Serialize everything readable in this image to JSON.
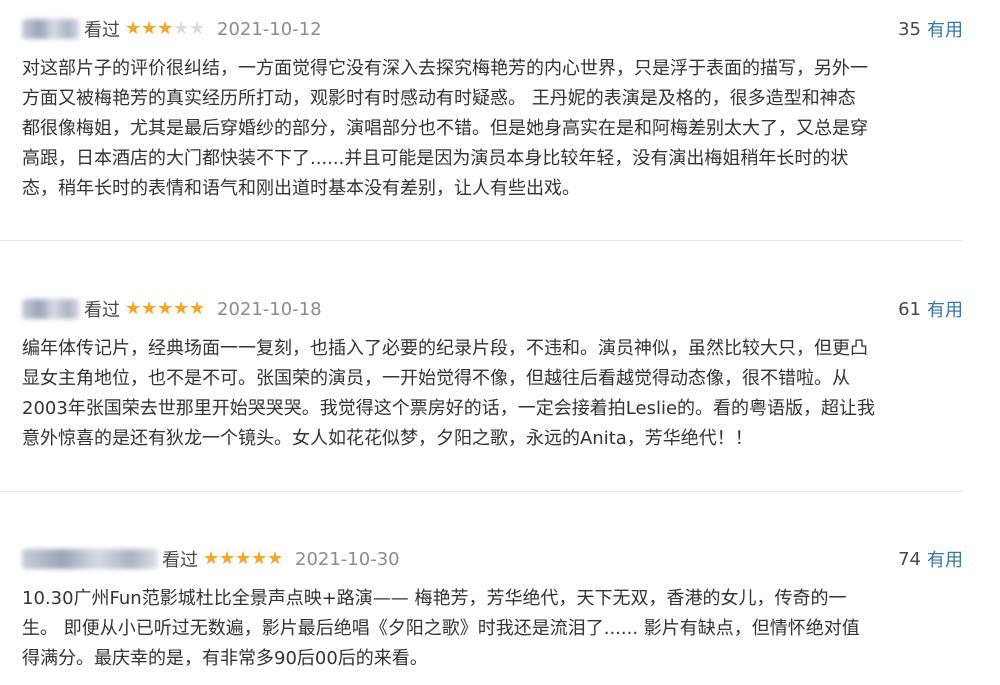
{
  "reviews": [
    {
      "watched_label": "看过",
      "rating": 3,
      "max_rating": 5,
      "date": "2021-10-12",
      "useful_count": "35",
      "useful_label": "有用",
      "lines": [
        "对这部片子的评价很纠结，一方面觉得它没有深入去探究梅艳芳的内心世界，只是浮于表面的描写，另外一",
        "方面又被梅艳芳的真实经历所打动，观影时有时感动有时疑惑。 王丹妮的表演是及格的，很多造型和神态",
        "都很像梅姐，尤其是最后穿婚纱的部分，演唱部分也不错。但是她身高实在是和阿梅差别太大了，又总是穿",
        "高跟，日本酒店的大门都快装不下了......并且可能是因为演员本身比较年轻，没有演出梅姐稍年长时的状",
        "态，稍年长时的表情和语气和刚出道时基本没有差别，让人有些出戏。"
      ]
    },
    {
      "watched_label": "看过",
      "rating": 5,
      "max_rating": 5,
      "date": "2021-10-18",
      "useful_count": "61",
      "useful_label": "有用",
      "lines": [
        "编年体传记片，经典场面一一复刻，也插入了必要的纪录片段，不违和。演员神似，虽然比较大只，但更凸",
        "显女主角地位，也不是不可。张国荣的演员，一开始觉得不像，但越往后看越觉得动态像，很不错啦。从",
        "2003年张国荣去世那里开始哭哭哭。我觉得这个票房好的话，一定会接着拍Leslie的。看的粤语版，超让我",
        "意外惊喜的是还有狄龙一个镜头。女人如花花似梦，夕阳之歌，永远的Anita，芳华绝代！！"
      ]
    },
    {
      "watched_label": "看过",
      "rating": 5,
      "max_rating": 5,
      "date": "2021-10-30",
      "useful_count": "74",
      "useful_label": "有用",
      "lines": [
        "10.30广州Fun范影城杜比全景声点映+路演—— 梅艳芳，芳华绝代，天下无双，香港的女儿，传奇的一",
        "生。 即便从小已听过无数遍，影片最后绝唱《夕阳之歌》时我还是流泪了...... 影片有缺点，但情怀绝对值",
        "得满分。最庆幸的是，有非常多90后00后的来看。"
      ]
    }
  ],
  "colors": {
    "star_on": "#f5a623",
    "star_off": "#dcdcdc",
    "link": "#3377aa",
    "date": "#8c8c8c",
    "text": "#333333"
  }
}
